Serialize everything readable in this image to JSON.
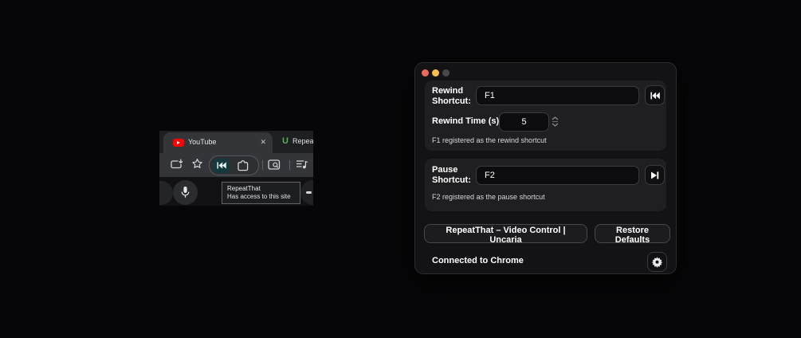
{
  "browser": {
    "tabs": [
      {
        "label": "YouTube",
        "favicon": "youtube-icon",
        "close_label": "✕",
        "active": true
      },
      {
        "label": "Repea",
        "logo_letter": "U",
        "favicon": "uncaria-icon",
        "active": false
      }
    ],
    "toolbar_icons": [
      "save-to-device-icon",
      "bookmark-star-icon",
      "rewind-extension-icon",
      "extensions-icon",
      "side-search-icon",
      "playlist-icon"
    ],
    "tooltip": {
      "title": "RepeatThat",
      "subtitle": "Has access to this site"
    },
    "content_icons": [
      "microphone-icon",
      "more-icon"
    ]
  },
  "app": {
    "traffic_lights": {
      "close": "#ec695e",
      "minimize": "#f4bf4e",
      "zoom_disabled": "#48484a"
    },
    "rewind": {
      "shortcut_label": "Rewind Shortcut:",
      "shortcut_value": "F1",
      "time_label": "Rewind Time (s):",
      "time_value": "5",
      "status": "F1 registered as the rewind shortcut",
      "side_icon": "rewind-icon"
    },
    "pause": {
      "shortcut_label": "Pause Shortcut:",
      "shortcut_value": "F2",
      "status": "F2 registered as the pause shortcut",
      "side_icon": "play-pause-icon"
    },
    "footer": {
      "app_button_label": "RepeatThat – Video Control | Uncaria",
      "restore_button_label": "Restore Defaults",
      "connection_status": "Connected to Chrome",
      "settings_icon": "gear-icon"
    }
  },
  "colors": {
    "youtube_red": "#ff0000",
    "uncaria_green": "#55b24e",
    "extension_badge_teal": "#16393e",
    "window_bg": "#131316",
    "card_bg": "#1f1f22"
  }
}
